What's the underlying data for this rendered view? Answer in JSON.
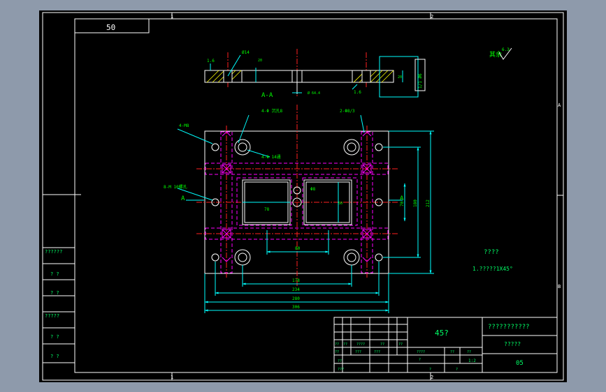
{
  "colors": {
    "background": "#8e9aab",
    "sheet": "#000000",
    "frame": "#ffffff",
    "dimension": "#00ffff",
    "centerline": "#ff2020",
    "hidden": "#ff00ff",
    "part": "#ffffff",
    "text_green": "#00ff00",
    "title_text": "#00ff66"
  },
  "frame": {
    "zone_top_1": "1",
    "zone_top_2": "2",
    "zone_bottom_1": "1",
    "zone_bottom_2": "2",
    "zone_right_a": "A",
    "zone_right_b": "B"
  },
  "stamp": {
    "drawing_number_box": "50"
  },
  "section_view": {
    "label": "A-A",
    "dim_hole": "Ø14",
    "dim_height": "20",
    "dim_slot": "Ø 64.4",
    "roughness_left": "1.6",
    "roughness_right": "1.6",
    "side_dim_a": "20",
    "side_dim_b": "1/1 Ø6"
  },
  "roughness_note": {
    "text": "其余",
    "value": "6.3"
  },
  "plan_view": {
    "callout_holes_4m": "4-M8",
    "callout_counterbore": "4-Φ 沉孔8",
    "callout_through": "4-Φ 14通",
    "callout_pin": "2-Φ8/3",
    "callout_tapped": "8-M 10螺孔",
    "section_mark_left": "A",
    "section_mark_right": "A",
    "center_hole": "Φ8",
    "window_width": "78",
    "window_height": "50",
    "pitch_80": "80",
    "dim_178": "178",
    "dim_234": "234",
    "dim_280": "280",
    "dim_306": "306",
    "vdim_70": "70",
    "vdim_180": "180",
    "vdim_212": "212"
  },
  "tech_requirements": {
    "heading": "????",
    "line_1": "1.?????1X45°"
  },
  "left_column": {
    "rows": [
      "??????",
      "? ?",
      "? ?",
      "?????",
      "? ?",
      "? ?"
    ]
  },
  "title_block": {
    "material": "45?",
    "part_name": "???????????",
    "drawing_code": "?????",
    "sheet_code": "05",
    "revision_cells": [
      "??",
      "??",
      "????",
      "??",
      "??"
    ],
    "sign_cells": [
      "??",
      "???",
      "???"
    ],
    "approve_cells": [
      "??",
      "???"
    ],
    "stage_labels": [
      "????",
      "??",
      "??"
    ],
    "stage_values": [
      "?",
      "?",
      "?",
      "1:2"
    ]
  }
}
